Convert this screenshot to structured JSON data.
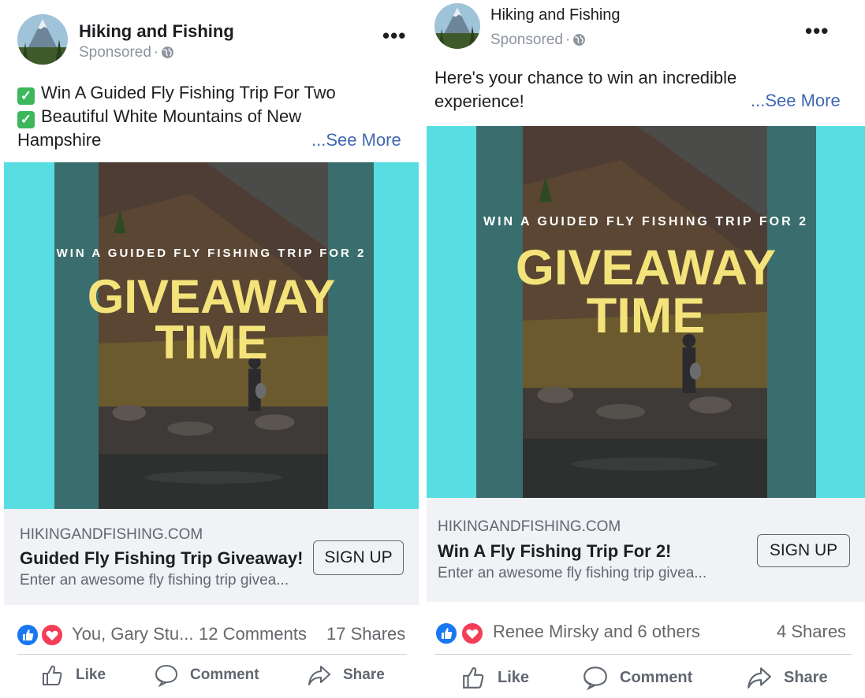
{
  "posts": [
    {
      "page_name": "Hiking and Fishing",
      "sponsored": "Sponsored",
      "caption_lines": [
        "Win A Guided Fly Fishing Trip For Two",
        "Beautiful White Mountains of New",
        "Hampshire"
      ],
      "see_more": "...See More",
      "creative": {
        "small_headline": "WIN A GUIDED FLY FISHING TRIP FOR 2",
        "big_line1": "GIVEAWAY",
        "big_line2": "TIME"
      },
      "link": {
        "domain": "HIKINGANDFISHING.COM",
        "title": "Guided Fly Fishing Trip Giveaway!",
        "description": "Enter an awesome fly fishing trip givea...",
        "cta": "SIGN UP"
      },
      "reactions_text": "You, Gary Stu...",
      "comments": "12 Comments",
      "shares": "17 Shares",
      "actions": {
        "like": "Like",
        "comment": "Comment",
        "share": "Share"
      }
    },
    {
      "page_name": "Hiking and Fishing",
      "sponsored": "Sponsored",
      "caption_lines": [
        "Here's your chance to win an incredible",
        "experience!"
      ],
      "see_more": "...See More",
      "creative": {
        "small_headline": "WIN A GUIDED FLY FISHING TRIP FOR 2",
        "big_line1": "GIVEAWAY",
        "big_line2": "TIME"
      },
      "link": {
        "domain": "HIKINGANDFISHING.COM",
        "title": "Win A Fly Fishing Trip For 2!",
        "description": "Enter an awesome fly fishing trip givea...",
        "cta": "SIGN UP"
      },
      "reactions_text": "Renee Mirsky and 6 others",
      "shares": "4 Shares",
      "actions": {
        "like": "Like",
        "comment": "Comment",
        "share": "Share"
      }
    }
  ],
  "colors": {
    "creative_background": "#58dde3",
    "creative_stripe": "#3a6e6e",
    "headline_yellow": "#f3e37a",
    "link_blue": "#4267b2",
    "like_blue": "#1877f2",
    "love_red": "#f33e58"
  },
  "icons": [
    "checkmark-icon",
    "globe-icon",
    "more-options-icon",
    "like-reaction-icon",
    "love-reaction-icon",
    "thumbs-up-icon",
    "comment-bubble-icon",
    "share-arrow-icon"
  ]
}
